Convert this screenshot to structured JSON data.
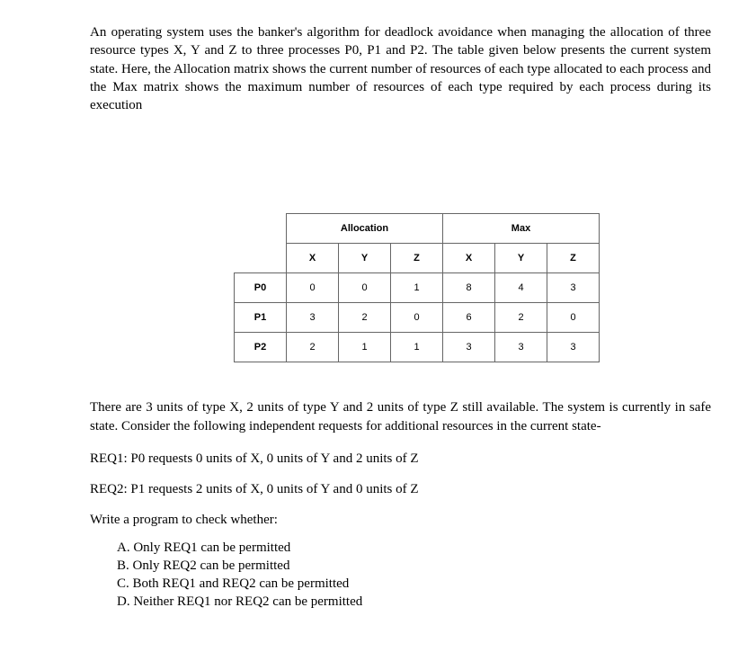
{
  "intro": "An operating system uses the banker's algorithm for deadlock avoidance when managing the allocation of three resource types X, Y and Z to three processes P0, P1 and P2. The table given below presents the current system state. Here, the Allocation matrix shows the current number of resources of each type allocated to each process and the Max matrix shows the maximum number of resources of each type required by each process during its execution",
  "table": {
    "group_alloc": "Allocation",
    "group_max": "Max",
    "cols": {
      "x": "X",
      "y": "Y",
      "z": "Z"
    },
    "rows": [
      {
        "proc": "P0",
        "ax": "0",
        "ay": "0",
        "az": "1",
        "mx": "8",
        "my": "4",
        "mz": "3"
      },
      {
        "proc": "P1",
        "ax": "3",
        "ay": "2",
        "az": "0",
        "mx": "6",
        "my": "2",
        "mz": "0"
      },
      {
        "proc": "P2",
        "ax": "2",
        "ay": "1",
        "az": "1",
        "mx": "3",
        "my": "3",
        "mz": "3"
      }
    ]
  },
  "available_para": "There are 3 units of type X, 2 units of type Y and 2 units of type Z still available. The system is currently in safe state. Consider the following independent requests for additional resources in the current state-",
  "req1": "REQ1: P0 requests 0 units of X, 0 units of Y and 2 units of Z",
  "req2": "REQ2: P1 requests 2 units of X, 0 units of Y and 0 units of Z",
  "prompt": "Write a program to check whether:",
  "options": {
    "a": "A.  Only REQ1 can be permitted",
    "b": "B.  Only REQ2 can be permitted",
    "c": "C.  Both REQ1 and REQ2 can be permitted",
    "d": "D.  Neither REQ1 nor REQ2 can be permitted"
  }
}
